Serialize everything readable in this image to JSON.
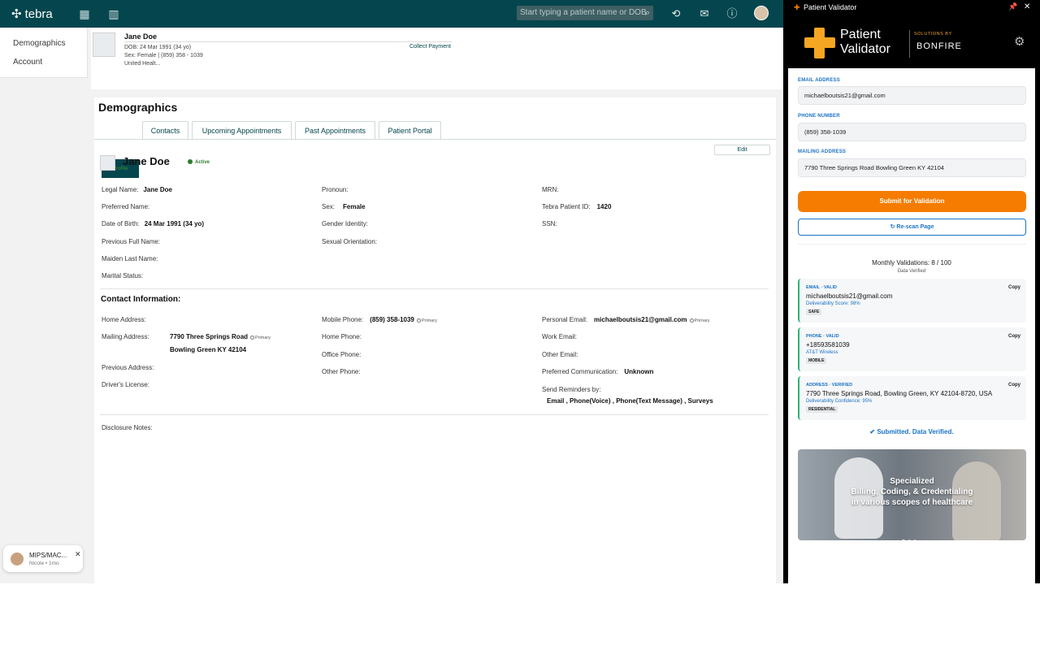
{
  "app": {
    "logo_text": "tebra"
  },
  "topbar": {
    "search_placeholder": "Start typing a patient name or DOB"
  },
  "leftnav": {
    "items": [
      "Demographics",
      "Account"
    ]
  },
  "patient_header": {
    "name": "Jane Doe",
    "dob": "DOB: 24 Mar 1991 (34 yo)",
    "sex_phone": "Sex: Female | (859) 358 - 1039",
    "insurance": "United Healt...",
    "collect_payment": "Collect Payment"
  },
  "demographics": {
    "title": "Demographics",
    "tabs": [
      "Profile",
      "Contacts",
      "Upcoming Appointments",
      "Past Appointments",
      "Patient Portal"
    ],
    "edit_label": "Edit",
    "patient_name": "Jane Doe",
    "status": "Active",
    "fields": {
      "legal_name_label": "Legal Name:",
      "legal_name": "Jane Doe",
      "preferred_name_label": "Preferred Name:",
      "dob_label": "Date of Birth:",
      "dob": "24 Mar 1991 (34 yo)",
      "prev_full_name_label": "Previous Full Name:",
      "maiden_label": "Maiden Last Name:",
      "marital_label": "Marital Status:",
      "pronoun_label": "Pronoun:",
      "sex_label": "Sex:",
      "sex": "Female",
      "gender_label": "Gender Identity:",
      "orientation_label": "Sexual Orientation:",
      "mrn_label": "MRN:",
      "tebra_id_label": "Tebra Patient ID:",
      "tebra_id": "1420",
      "ssn_label": "SSN:"
    },
    "contact": {
      "heading": "Contact Information:",
      "home_address_label": "Home Address:",
      "mailing_address_label": "Mailing Address:",
      "mailing_line1": "7790 Three Springs Road",
      "mailing_line2": "Bowling Green KY 42104",
      "primary": "Primary",
      "previous_address_label": "Previous Address:",
      "drivers_license_label": "Driver's License:",
      "mobile_label": "Mobile Phone:",
      "mobile": "(859) 358-1039",
      "home_phone_label": "Home Phone:",
      "office_phone_label": "Office Phone:",
      "other_phone_label": "Other Phone:",
      "personal_email_label": "Personal Email:",
      "personal_email": "michaelboutsis21@gmail.com",
      "work_email_label": "Work Email:",
      "other_email_label": "Other Email:",
      "pref_comm_label": "Preferred Communication:",
      "pref_comm": "Unknown",
      "reminders_label": "Send Reminders by:",
      "reminders": "Email , Phone(Voice) , Phone(Text Message) , Surveys"
    },
    "disclosure_label": "Disclosure Notes:"
  },
  "chat_chip": {
    "title": "MIPS/MAC...",
    "subtitle": "Nicole • 1mo"
  },
  "validator": {
    "window_title": "Patient Validator",
    "brand_line1": "Patient",
    "brand_line2": "Validator",
    "solutions_by": "SOLUTIONS BY",
    "partner": "BONFIRE",
    "email_label": "EMAIL ADDRESS",
    "email_value": "michaelboutsis21@gmail.com",
    "phone_label": "PHONE NUMBER",
    "phone_value": "(859) 358-1039",
    "mailing_label": "MAILING ADDRESS",
    "mailing_value": "7790 Three Springs Road Bowling Green KY 42104",
    "submit_label": "Submit for Validation",
    "rescan_label": "↻ Re-scan Page",
    "monthly": "Monthly Validations: 8 / 100",
    "data_verified": "Data Verified",
    "results": [
      {
        "header": "EMAIL · VALID",
        "value": "michaelboutsis21@gmail.com",
        "sub": "Deliverability Score: 98%",
        "tag": "SAFE",
        "copy": "Copy"
      },
      {
        "header": "PHONE · VALID",
        "value": "+18593581039",
        "sub": "AT&T Wireless",
        "tag": "MOBILE",
        "copy": "Copy"
      },
      {
        "header": "ADDRESS · VERIFIED",
        "value": "7790 Three Springs Road, Bowling Green, KY 42104-8720, USA",
        "sub": "Deliverability Confidence: 95%",
        "tag": "RESIDENTIAL",
        "copy": "Copy"
      }
    ],
    "submitted": "✔ Submitted. Data Verified.",
    "promo_line1": "Specialized",
    "promo_line2": "Billing, Coding, & Credentialing",
    "promo_line3": "in various scopes of healthcare"
  },
  "colors": {
    "brand_teal": "#05464e",
    "accent_orange": "#f57c00",
    "link_blue": "#1a73c5",
    "valid_green": "#2bb673"
  }
}
